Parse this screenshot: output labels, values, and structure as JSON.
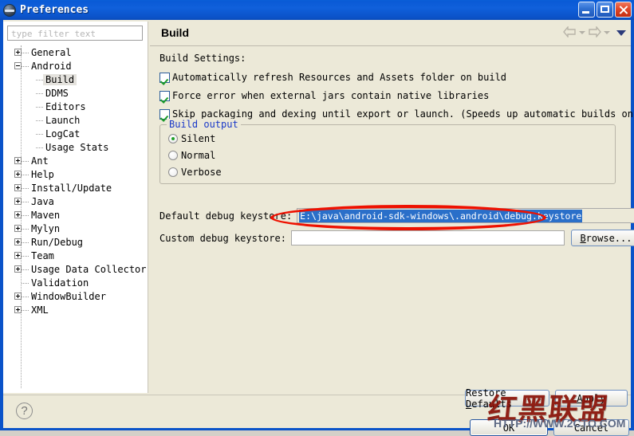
{
  "window": {
    "title": "Preferences",
    "icon": "eclipse-globe-icon",
    "buttons": {
      "minimize": "minimize-icon",
      "maximize": "maximize-icon",
      "close": "close-icon"
    }
  },
  "sidebar": {
    "filter": {
      "placeholder": "type filter text",
      "value": ""
    },
    "items": [
      {
        "label": "General",
        "state": "collapsed",
        "depth": 0,
        "selected": false
      },
      {
        "label": "Android",
        "state": "expanded",
        "depth": 0,
        "selected": false
      },
      {
        "label": "Build",
        "state": "leaf",
        "depth": 1,
        "selected": true
      },
      {
        "label": "DDMS",
        "state": "leaf",
        "depth": 1,
        "selected": false
      },
      {
        "label": "Editors",
        "state": "leaf",
        "depth": 1,
        "selected": false
      },
      {
        "label": "Launch",
        "state": "leaf",
        "depth": 1,
        "selected": false
      },
      {
        "label": "LogCat",
        "state": "leaf",
        "depth": 1,
        "selected": false
      },
      {
        "label": "Usage Stats",
        "state": "leaf",
        "depth": 1,
        "selected": false
      },
      {
        "label": "Ant",
        "state": "collapsed",
        "depth": 0,
        "selected": false
      },
      {
        "label": "Help",
        "state": "collapsed",
        "depth": 0,
        "selected": false
      },
      {
        "label": "Install/Update",
        "state": "collapsed",
        "depth": 0,
        "selected": false
      },
      {
        "label": "Java",
        "state": "collapsed",
        "depth": 0,
        "selected": false
      },
      {
        "label": "Maven",
        "state": "collapsed",
        "depth": 0,
        "selected": false
      },
      {
        "label": "Mylyn",
        "state": "collapsed",
        "depth": 0,
        "selected": false
      },
      {
        "label": "Run/Debug",
        "state": "collapsed",
        "depth": 0,
        "selected": false
      },
      {
        "label": "Team",
        "state": "collapsed",
        "depth": 0,
        "selected": false
      },
      {
        "label": "Usage Data Collector",
        "state": "collapsed",
        "depth": 0,
        "selected": false
      },
      {
        "label": "Validation",
        "state": "leaf",
        "depth": 0,
        "selected": false
      },
      {
        "label": "WindowBuilder",
        "state": "collapsed",
        "depth": 0,
        "selected": false
      },
      {
        "label": "XML",
        "state": "collapsed",
        "depth": 0,
        "selected": false
      }
    ]
  },
  "header": {
    "title": "Build",
    "back_icon": "back-arrow-icon",
    "forward_icon": "forward-arrow-icon",
    "menu_icon": "view-menu-chevron-icon"
  },
  "main": {
    "section_label": "Build Settings:",
    "checkboxes": [
      {
        "label": "Automatically refresh Resources and Assets folder on build",
        "checked": true
      },
      {
        "label": "Force error when external jars contain native libraries",
        "checked": true
      },
      {
        "label": "Skip packaging and dexing until export or launch.  (Speeds up automatic builds on file save)",
        "checked": true
      }
    ],
    "build_output": {
      "legend": "Build output",
      "options": [
        {
          "label": "Silent",
          "selected": true
        },
        {
          "label": "Normal",
          "selected": false
        },
        {
          "label": "Verbose",
          "selected": false
        }
      ]
    },
    "default_keystore": {
      "label": "Default debug keystore:",
      "value": "E:\\java\\android-sdk-windows\\.android\\debug.keystore",
      "selected": true,
      "enabled": false
    },
    "custom_keystore": {
      "label": "Custom debug keystore:",
      "value": "",
      "browse_label": "Browse..."
    }
  },
  "footer": {
    "help_icon": "help-question-icon",
    "restore_defaults": "Restore Defaults",
    "apply": "Apply",
    "ok": "OK",
    "cancel": "Cancel"
  },
  "watermark": {
    "brand": "红黑联盟",
    "url": "HTTP://WWW.2CTO.COM"
  },
  "colors": {
    "title_bar": "#0a5ad6",
    "dialog_bg": "#ece9d8",
    "annotation": "#ee1100",
    "selection": "#2a6fc9",
    "legend": "#1a39c8"
  }
}
